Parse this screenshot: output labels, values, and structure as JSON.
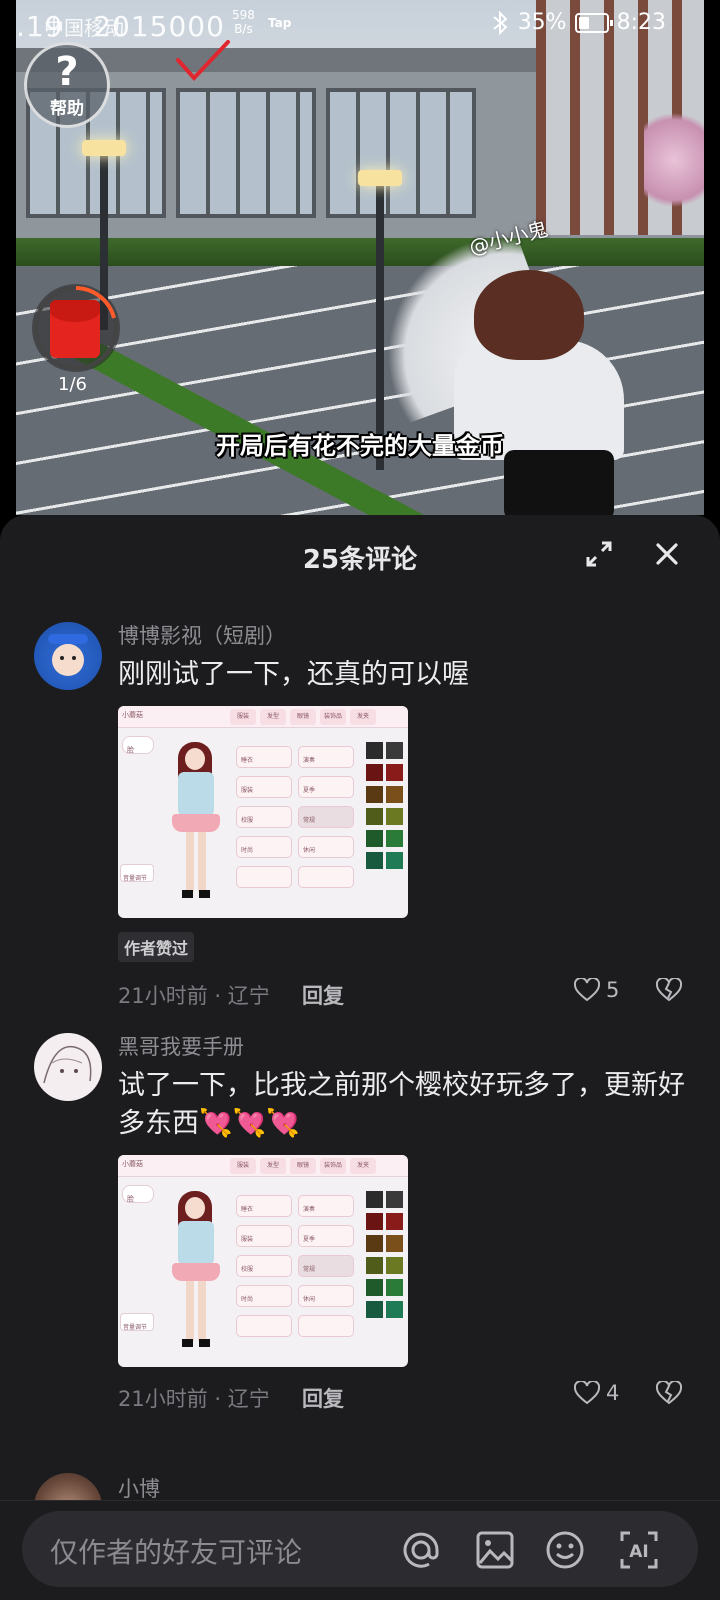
{
  "status_bar": {
    "carrier": "中国移动",
    "speed_value": "598",
    "speed_unit": "B/s",
    "tap_label": "Tap",
    "battery": "35%",
    "clock": "8:23",
    "icons": [
      "bluetooth-icon",
      "battery-icon"
    ]
  },
  "video": {
    "watermark_time": ".19 · 2015000",
    "help_label": "帮助",
    "redpacket_count": "1/6",
    "creator_tag": "@小小鬼",
    "subtitle": "开局后有花不完的大量金币"
  },
  "comments_panel": {
    "title": "25条评论",
    "icons": [
      "expand-icon",
      "close-icon"
    ]
  },
  "comments": [
    {
      "user": "博博影视（短剧）",
      "text": "刚刚试了一下，还真的可以喔",
      "badge": "作者赞过",
      "time_location": "21小时前 · 辽宁",
      "reply_label": "回复",
      "likes": "5"
    },
    {
      "user": "黑哥我要手册",
      "text": "试了一下，比我之前那个樱校好玩多了，更新好多东西💘💘💘",
      "time_location": "21小时前 · 辽宁",
      "reply_label": "回复",
      "likes": "4"
    },
    {
      "user": "小博"
    }
  ],
  "game_screenshot": {
    "search_text": "小蘑菇",
    "tabs": [
      "服装",
      "发型",
      "眼镜",
      "装饰品",
      "发夹"
    ],
    "options": [
      "睡衣",
      "演奏",
      "服装",
      "夏季",
      "校服",
      "常规",
      "时尚",
      "休闲"
    ],
    "left_label": "脸",
    "bottom_label": "音量调节"
  },
  "bottom_bar": {
    "placeholder": "仅作者的好友可评论",
    "icons": [
      "at-icon",
      "image-icon",
      "emoji-icon",
      "ai-icon"
    ]
  }
}
